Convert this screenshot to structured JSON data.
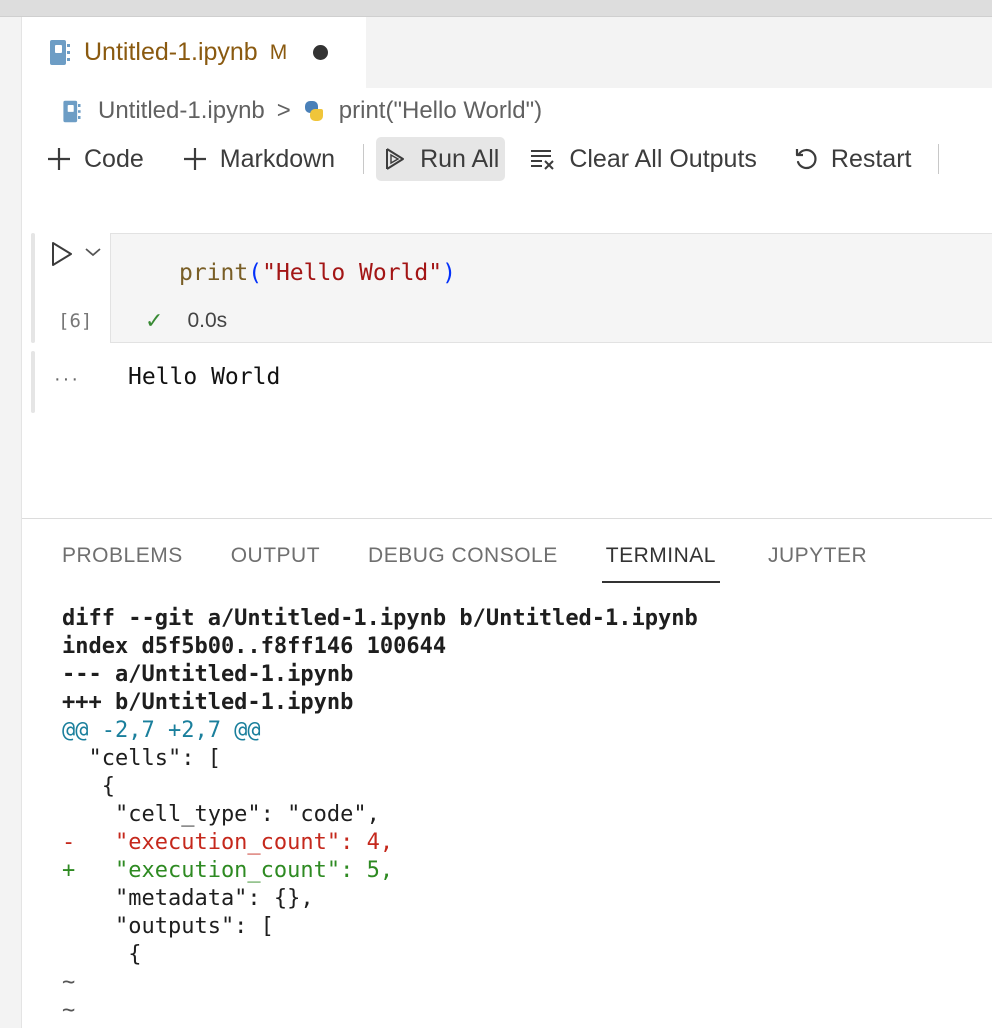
{
  "tab": {
    "filename": "Untitled-1.ipynb",
    "status": "M"
  },
  "breadcrumb": {
    "file": "Untitled-1.ipynb",
    "separator": ">",
    "cell": "print(\"Hello World\")"
  },
  "toolbar": {
    "code_label": "Code",
    "markdown_label": "Markdown",
    "run_all_label": "Run All",
    "clear_outputs_label": "Clear All Outputs",
    "restart_label": "Restart"
  },
  "cell": {
    "execution_count": "[6]",
    "code_fn": "print",
    "code_open": "(",
    "code_string": "\"Hello World\"",
    "code_close": ")",
    "duration": "0.0s",
    "output_prefix": "···",
    "output": "Hello World"
  },
  "panel": {
    "tabs": [
      "PROBLEMS",
      "OUTPUT",
      "DEBUG CONSOLE",
      "TERMINAL",
      "JUPYTER"
    ],
    "active_tab": "TERMINAL"
  },
  "terminal_lines": [
    {
      "kind": "header",
      "text": "diff --git a/Untitled-1.ipynb b/Untitled-1.ipynb"
    },
    {
      "kind": "header",
      "text": "index d5f5b00..f8ff146 100644"
    },
    {
      "kind": "header",
      "text": "--- a/Untitled-1.ipynb"
    },
    {
      "kind": "header",
      "text": "+++ b/Untitled-1.ipynb"
    },
    {
      "kind": "hunk",
      "text": "@@ -2,7 +2,7 @@"
    },
    {
      "kind": "ctx",
      "text": "  \"cells\": ["
    },
    {
      "kind": "ctx",
      "text": "   {"
    },
    {
      "kind": "ctx",
      "text": "    \"cell_type\": \"code\","
    },
    {
      "kind": "del",
      "text": "-   \"execution_count\": 4,"
    },
    {
      "kind": "add",
      "text": "+   \"execution_count\": 5,"
    },
    {
      "kind": "ctx",
      "text": "    \"metadata\": {},"
    },
    {
      "kind": "ctx",
      "text": "    \"outputs\": ["
    },
    {
      "kind": "ctx",
      "text": "     {"
    },
    {
      "kind": "tilde",
      "text": "~"
    },
    {
      "kind": "tilde",
      "text": "~"
    }
  ],
  "colors": {
    "tab_text": "#8a5a10",
    "diff_add": "#2e8a22",
    "diff_del": "#c5281c",
    "diff_hunk": "#1a7f9c",
    "success_check": "#388a34"
  }
}
